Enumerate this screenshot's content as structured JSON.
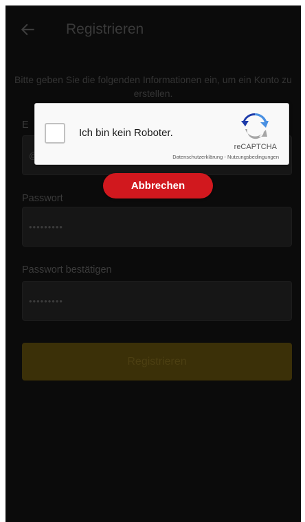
{
  "appbar": {
    "back_icon": "arrow-left-icon",
    "title": "Registrieren"
  },
  "intro": {
    "text": "Bitte geben Sie die folgenden Informationen ein, um ein Konto zu erstellen."
  },
  "form": {
    "email": {
      "label_visible": "E",
      "value_partial": "@"
    },
    "password": {
      "label": "Passwort",
      "value": "•••••••••"
    },
    "password_confirm": {
      "label": "Passwort bestätigen",
      "value": "•••••••••"
    },
    "submit_label": "Registrieren"
  },
  "captcha": {
    "checkbox_label": "Ich bin kein Roboter.",
    "brand": "reCAPTCHA",
    "privacy_link": "Datenschutzerklärung",
    "separator": " - ",
    "terms_link": "Nutzungsbedingungen",
    "logo_icon": "recaptcha-logo-icon"
  },
  "cancel_button": {
    "label": "Abbrechen"
  },
  "colors": {
    "background": "#0b0b0b",
    "dim_text": "#3a3a3a",
    "field_bg": "#161616",
    "submit_bg": "#3b3008",
    "cancel_bg": "#d1181e",
    "captcha_bg": "#f9f9f9"
  }
}
